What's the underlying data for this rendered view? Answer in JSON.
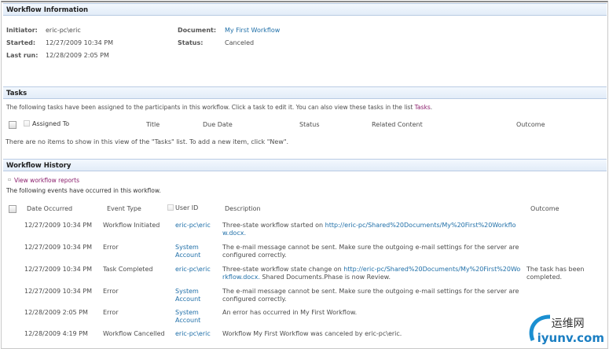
{
  "info": {
    "title": "Workflow Information",
    "initiator_label": "Initiator:",
    "initiator": "eric-pc\\eric",
    "started_label": "Started:",
    "started": "12/27/2009 10:34 PM",
    "lastrun_label": "Last run:",
    "lastrun": "12/28/2009 2:05 PM",
    "document_label": "Document:",
    "document": "My First Workflow",
    "status_label": "Status:",
    "status": "Canceled"
  },
  "tasks": {
    "title": "Tasks",
    "intro": "The following tasks have been assigned to the participants in this workflow. Click a task to edit it. You can also view these tasks in the list",
    "intro_link": "Tasks",
    "columns": [
      "Assigned To",
      "Title",
      "Due Date",
      "Status",
      "Related Content",
      "Outcome"
    ],
    "empty": "There are no items to show in this view of the \"Tasks\" list. To add a new item, click \"New\"."
  },
  "history": {
    "title": "Workflow History",
    "reports_link": "View workflow reports",
    "intro": "The following events have occurred in this workflow.",
    "columns": [
      "Date Occurred",
      "Event Type",
      "User ID",
      "Description",
      "Outcome"
    ],
    "rows": [
      {
        "date": "12/27/2009 10:34 PM",
        "event": "Workflow Initiated",
        "user": "eric-pc\\eric",
        "desc": "Three-state workflow started on ",
        "desc_link": "http://eric-pc/Shared%20Documents/My%20First%20Workflow.docx.",
        "desc_after": "",
        "outcome": ""
      },
      {
        "date": "12/27/2009 10:34 PM",
        "event": "Error",
        "user": "System Account",
        "desc": "The e-mail message cannot be sent. Make sure the outgoing e-mail settings for the server are configured correctly.",
        "desc_link": "",
        "desc_after": "",
        "outcome": ""
      },
      {
        "date": "12/27/2009 10:34 PM",
        "event": "Task Completed",
        "user": "eric-pc\\eric",
        "desc": "Three-state workflow state change on ",
        "desc_link": "http://eric-pc/Shared%20Documents/My%20First%20Workflow.docx.",
        "desc_after": " Shared Documents.Phase is now Review.",
        "outcome": "The task has been completed."
      },
      {
        "date": "12/27/2009 10:34 PM",
        "event": "Error",
        "user": "System Account",
        "desc": "The e-mail message cannot be sent. Make sure the outgoing e-mail settings for the server are configured correctly.",
        "desc_link": "",
        "desc_after": "",
        "outcome": ""
      },
      {
        "date": "12/28/2009 2:05 PM",
        "event": "Error",
        "user": "System Account",
        "desc": "An error has occurred in My First Workflow.",
        "desc_link": "",
        "desc_after": "",
        "outcome": ""
      },
      {
        "date": "12/28/2009 4:19 PM",
        "event": "Workflow Cancelled",
        "user": "eric-pc\\eric",
        "desc": "Workflow My First Workflow was canceled by eric-pc\\eric.",
        "desc_link": "",
        "desc_after": "",
        "outcome": ""
      }
    ]
  },
  "watermark": {
    "cn": "运维网",
    "en": "iyunv.com"
  }
}
